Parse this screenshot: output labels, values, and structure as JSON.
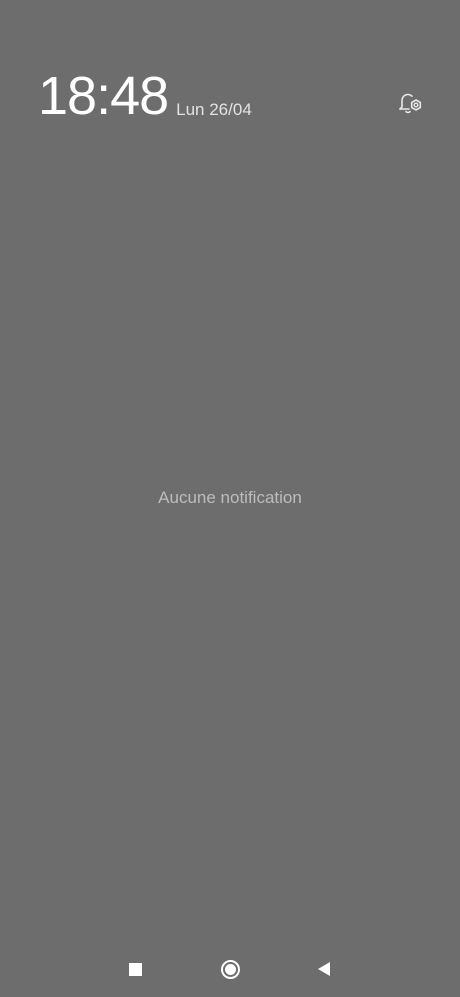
{
  "status": {
    "time": "18:48",
    "date": "Lun 26/04"
  },
  "icons": {
    "notification_settings": "bell-gear-icon",
    "nav_recents": "square-icon",
    "nav_home": "circle-icon",
    "nav_back": "triangle-back-icon"
  },
  "notifications": {
    "empty_message": "Aucune notification"
  },
  "colors": {
    "background": "#6d6d6d",
    "text_primary": "#ffffff",
    "text_muted": "#bcbcbc"
  }
}
